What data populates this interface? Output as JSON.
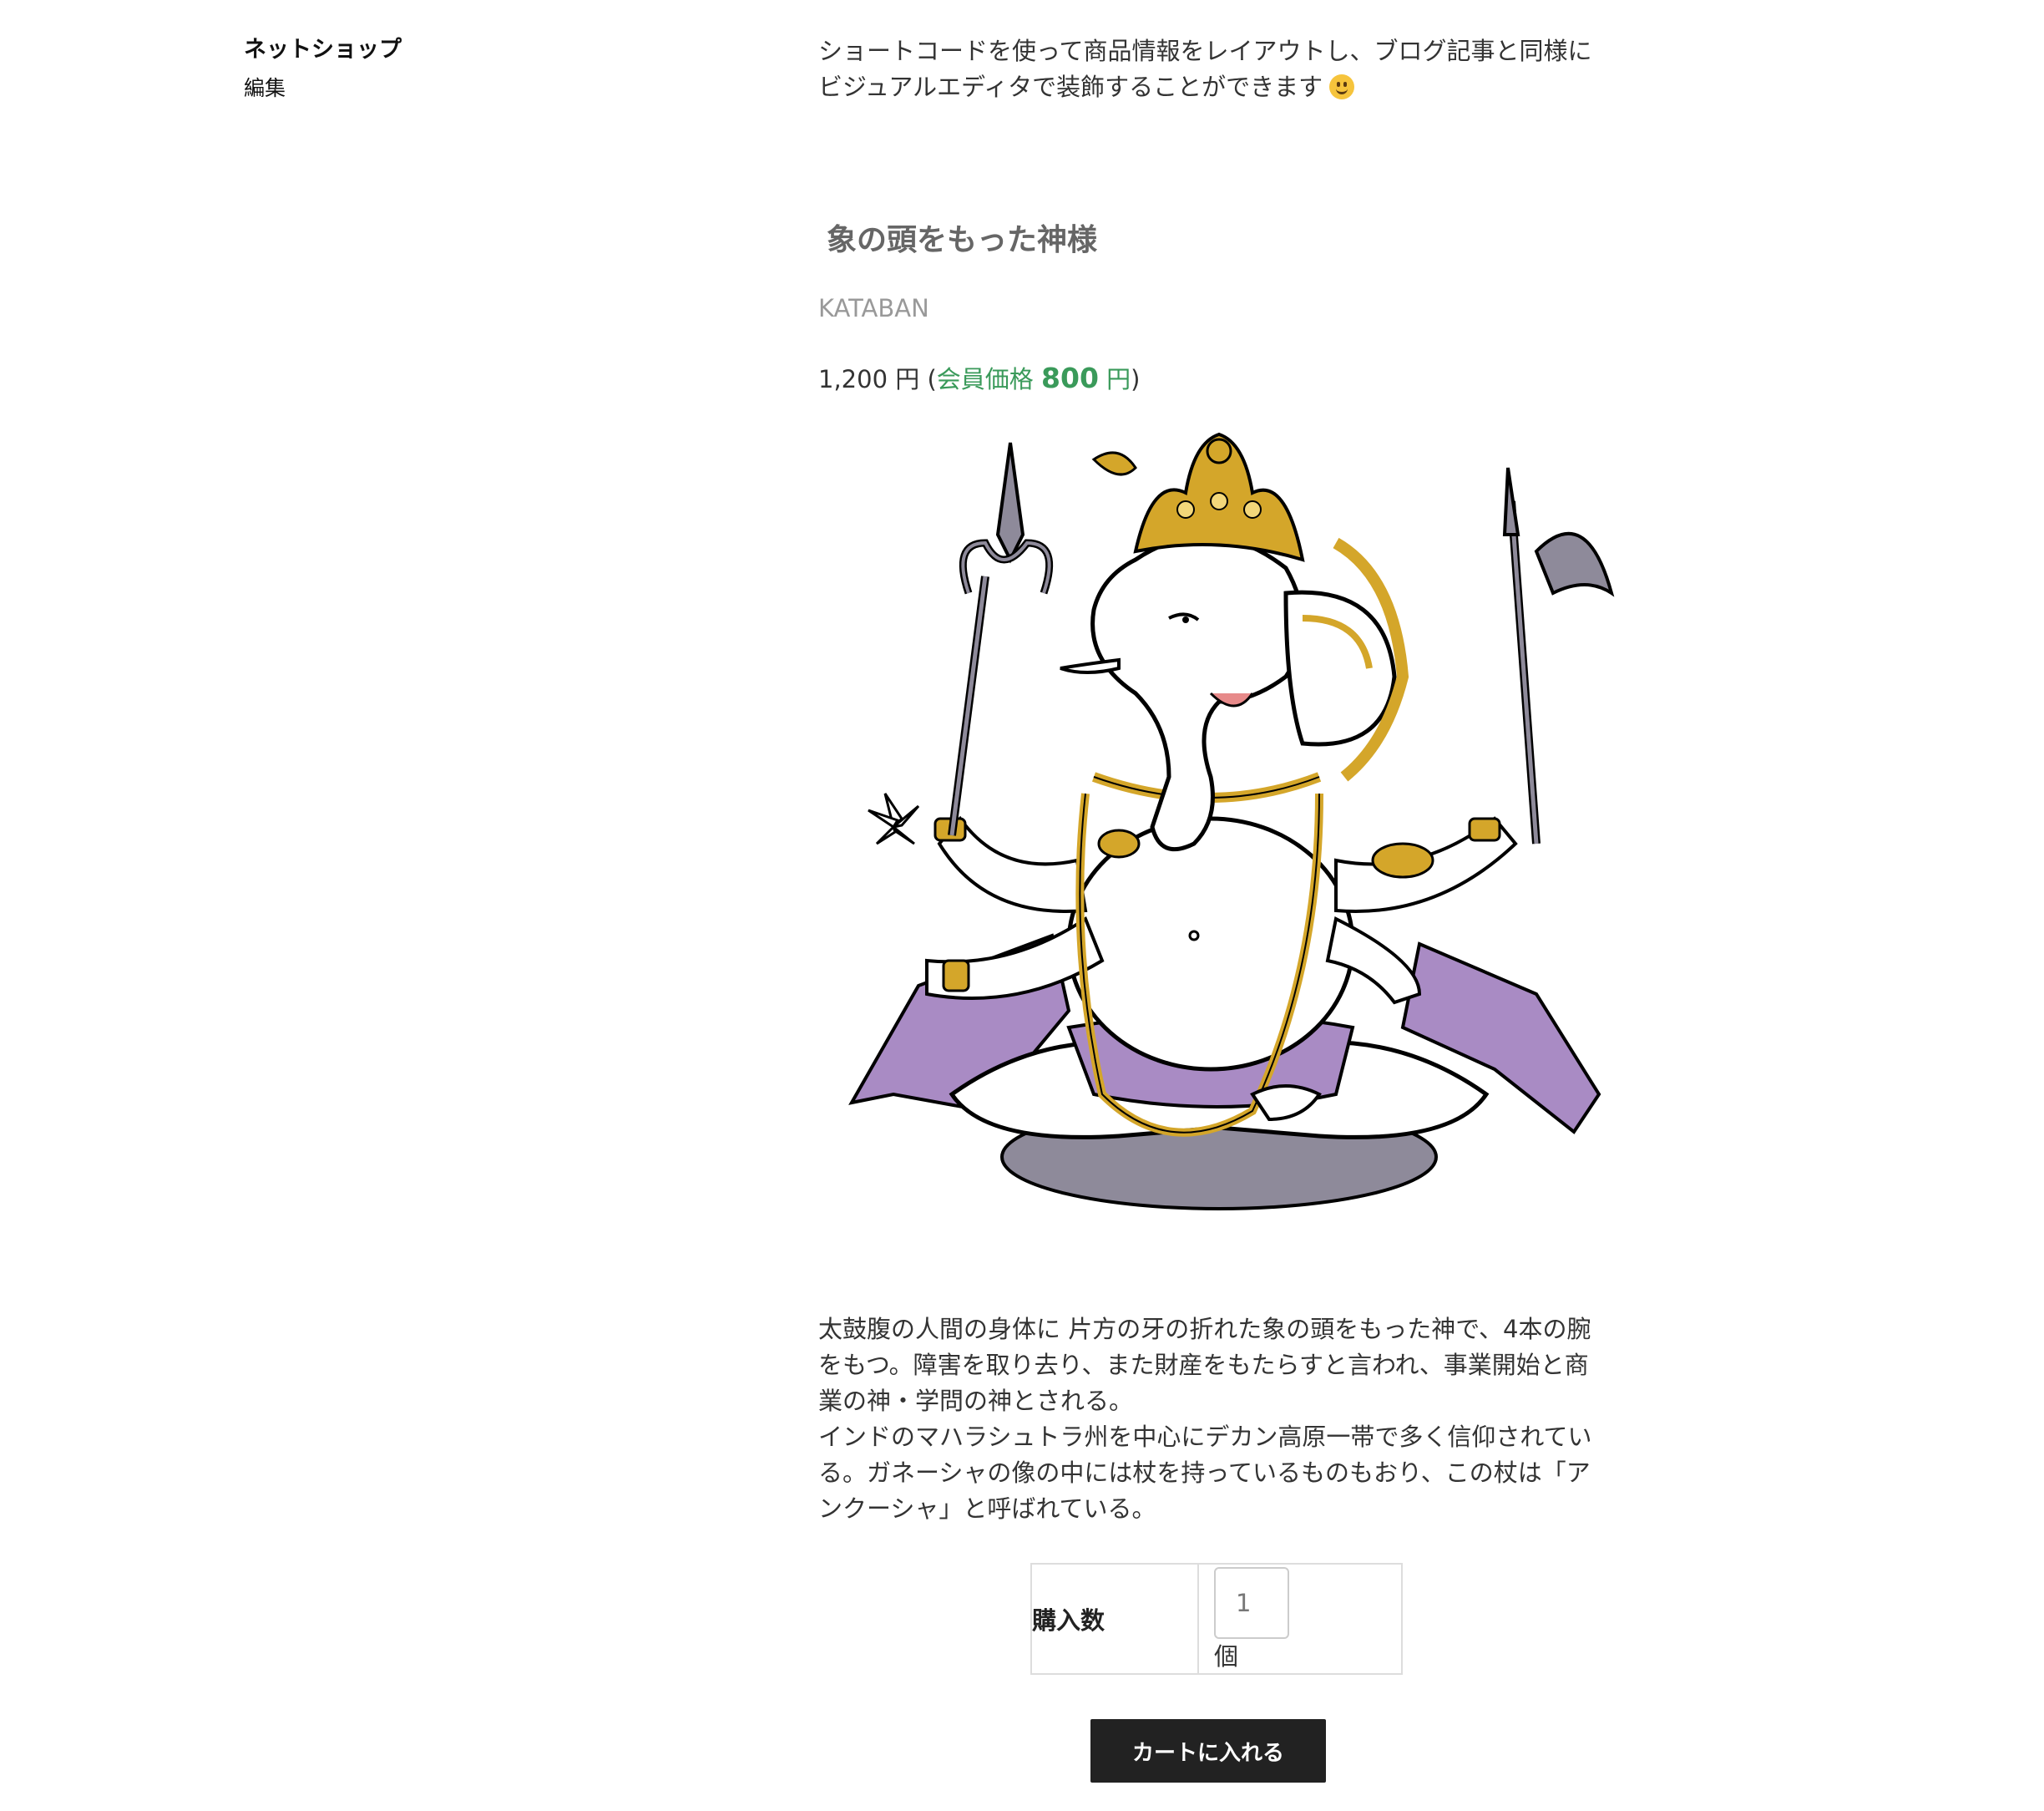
{
  "sidebar": {
    "title": "ネットショップ",
    "edit_label": "編集"
  },
  "intro": {
    "text": "ショートコードを使って商品情報をレイアウトし、ブログ記事と同様にビジュアルエディタで装飾することができます",
    "emoji_icon": "smiley-icon"
  },
  "product": {
    "name": "象の頭をもった神様",
    "code": "KATABAN",
    "price": "1,200 円",
    "member_price_label": "会員価格",
    "member_price_value": "800",
    "member_price_unit": "円",
    "image_icon": "ganesha-illustration",
    "description": [
      "太鼓腹の人間の身体に 片方の牙の折れた象の頭をもった神で、4本の腕をもつ。障害を取り去り、また財産をもたらすと言われ、事業開始と商業の神・学問の神とされる。",
      "インドのマハラシュトラ州を中心にデカン高原一帯で多く信仰されている。ガネーシャの像の中には杖を持っているものもおり、この杖は「アンクーシャ」と呼ばれている。"
    ]
  },
  "cart": {
    "quantity_label": "購入数",
    "quantity_value": "1",
    "quantity_unit": "個",
    "add_to_cart_label": "カートに入れる"
  },
  "colors": {
    "member_price": "#3a9a5a",
    "button_bg": "#222222",
    "gold": "#d4a62a",
    "purple": "#a98bc4"
  }
}
